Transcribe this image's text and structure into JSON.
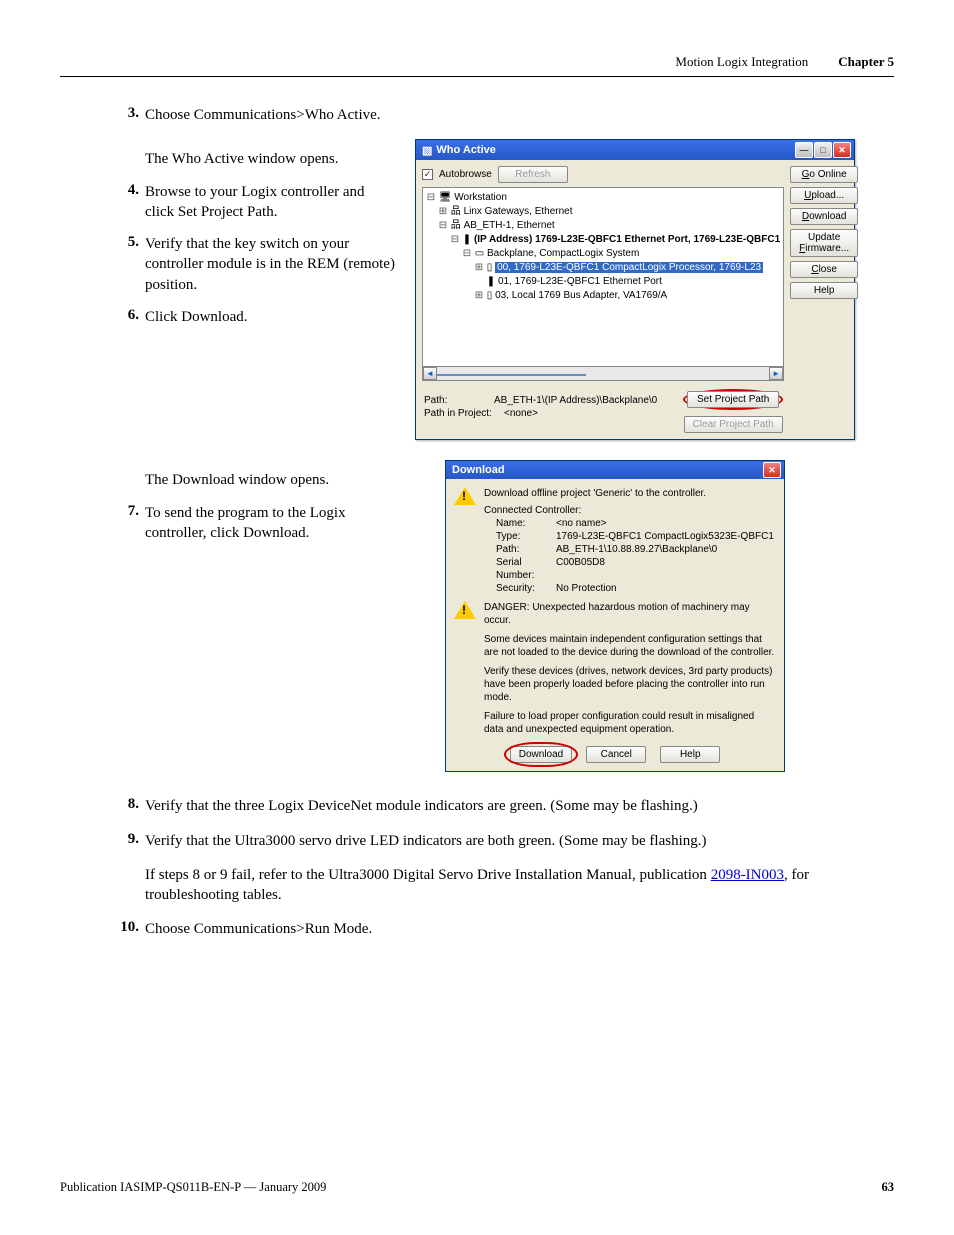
{
  "header": {
    "section": "Motion Logix Integration",
    "chapter": "Chapter 5"
  },
  "steps": {
    "s3": "Choose Communications>Who Active.",
    "s3_after": "The Who Active window opens.",
    "s4": "Browse to your Logix controller and click Set Project Path.",
    "s5": "Verify that the key switch on your controller module is in the REM (remote) position.",
    "s6": "Click Download.",
    "s6_after": "The Download window opens.",
    "s7": "To send the program to the Logix controller, click Download.",
    "s8": "Verify that the three Logix DeviceNet module indicators are green. (Some may be flashing.)",
    "s9": "Verify that the Ultra3000 servo drive LED indicators are both green. (Some may be flashing.)",
    "s9_after_a": "If steps 8 or 9 fail, refer to the Ultra3000 Digital Servo Drive Installation Manual, publication ",
    "s9_link": "2098-IN003",
    "s9_after_b": ", for troubleshooting tables.",
    "s10": "Choose Communications>Run Mode."
  },
  "who_active": {
    "title": "Who Active",
    "autobrowse_label": "Autobrowse",
    "refresh_label": "Refresh",
    "side_buttons": {
      "go_online": "Go Online",
      "upload": "Upload...",
      "download": "Download",
      "update_fw": "Update Firmware...",
      "close": "Close",
      "help": "Help"
    },
    "tree": {
      "workstation": "Workstation",
      "linx": "Linx Gateways, Ethernet",
      "ab_eth": "AB_ETH-1, Ethernet",
      "ip_line": "(IP Address) 1769-L23E-QBFC1 Ethernet Port, 1769-L23E-QBFC1",
      "backplane": "Backplane, CompactLogix System",
      "slot0": "00, 1769-L23E-QBFC1 CompactLogix Processor, 1769-L23",
      "slot1": "01, 1769-L23E-QBFC1 Ethernet Port",
      "slot3": "03, Local 1769 Bus Adapter, VA1769/A"
    },
    "path_label": "Path:",
    "path_value": "AB_ETH-1\\(IP Address)\\Backplane\\0",
    "path_in_project_label": "Path in Project:",
    "path_in_project_value": "<none>",
    "set_project_path": "Set Project Path",
    "clear_project_path": "Clear Project Path"
  },
  "download_dlg": {
    "title": "Download",
    "line1": "Download offline project 'Generic' to the controller.",
    "connected_label": "Connected Controller:",
    "name_k": "Name:",
    "name_v": "<no name>",
    "type_k": "Type:",
    "type_v": "1769-L23E-QBFC1 CompactLogix5323E-QBFC1",
    "path_k": "Path:",
    "path_v": "AB_ETH-1\\10.88.89.27\\Backplane\\0",
    "serial_k": "Serial Number:",
    "serial_v": "C00B05D8",
    "security_k": "Security:",
    "security_v": "No Protection",
    "danger": "DANGER: Unexpected hazardous motion of machinery may occur.",
    "p1": "Some devices maintain independent configuration settings that are not loaded to the device during the download of the controller.",
    "p2": "Verify these devices (drives, network devices, 3rd party products) have been properly loaded before placing the controller into run mode.",
    "p3": "Failure to load proper configuration could result in misaligned data and unexpected equipment operation.",
    "btn_download": "Download",
    "btn_cancel": "Cancel",
    "btn_help": "Help"
  },
  "footer": {
    "pub": "Publication IASIMP-QS011B-EN-P — January 2009",
    "page": "63"
  }
}
